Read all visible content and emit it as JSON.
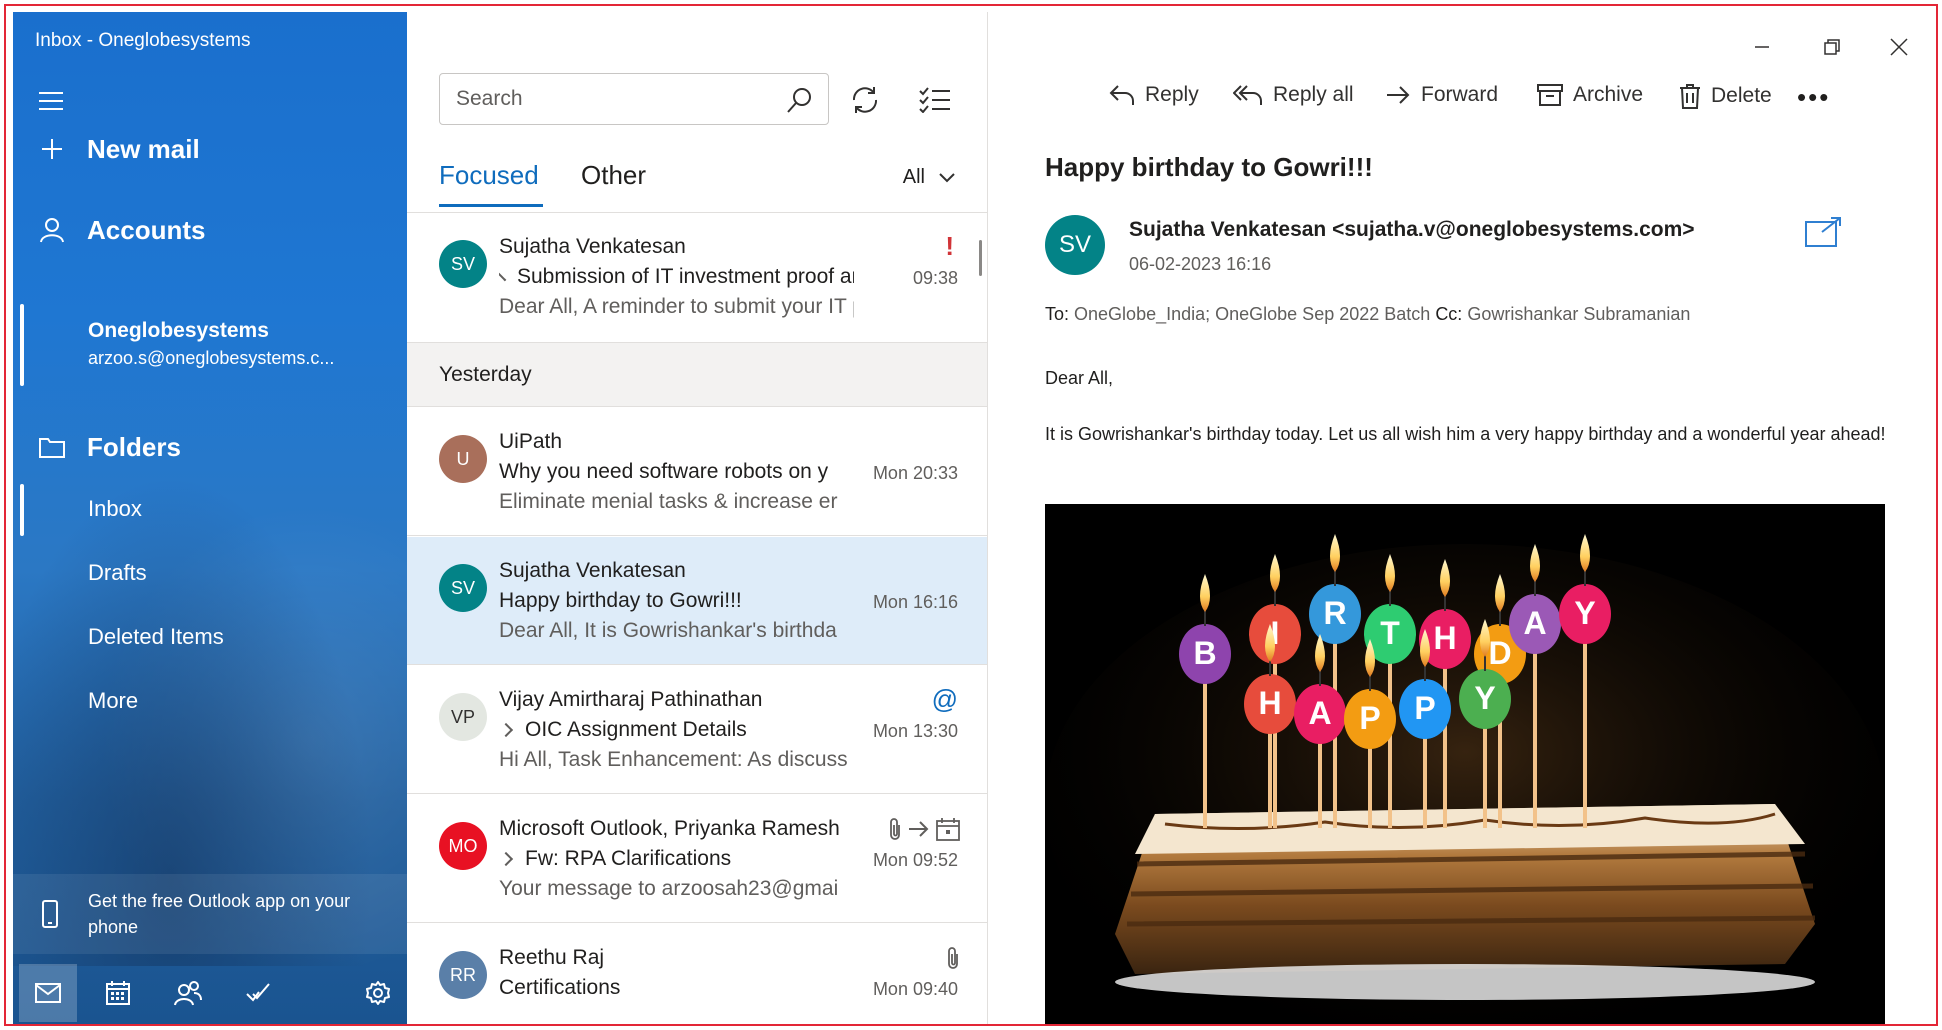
{
  "window": {
    "title": "Inbox - Oneglobesystems"
  },
  "nav": {
    "new_mail": "New mail",
    "accounts": "Accounts",
    "account_name": "Oneglobesystems",
    "account_email": "arzoo.s@oneglobesystems.c...",
    "folders": "Folders",
    "folder_items": [
      "Inbox",
      "Drafts",
      "Deleted Items",
      "More"
    ],
    "promo": "Get the free Outlook app on your phone"
  },
  "list": {
    "search_placeholder": "Search",
    "tabs": [
      "Focused",
      "Other"
    ],
    "filter": "All",
    "section_yesterday": "Yesterday",
    "messages": [
      {
        "initials": "SV",
        "color": "#038387",
        "from": "Sujatha Venkatesan",
        "subject": "Submission of IT investment proof and",
        "preview": "Dear All, A reminder to submit your IT pr",
        "time": "09:38",
        "flag": "!"
      },
      {
        "initials": "U",
        "color": "#a96f5b",
        "from": "UiPath",
        "subject": "Why you need software robots on y",
        "preview": "Eliminate menial tasks & increase er",
        "time": "Mon 20:33"
      },
      {
        "initials": "SV",
        "color": "#038387",
        "from": "Sujatha Venkatesan",
        "subject": "Happy birthday to Gowri!!!",
        "preview": "Dear All, It is Gowrishankar's birthda",
        "time": "Mon 16:16"
      },
      {
        "initials": "VP",
        "color": "#e3e7e1",
        "from": "Vijay Amirtharaj Pathinathan",
        "subject": "OIC Assignment Details",
        "preview": "Hi All, Task Enhancement: As discuss",
        "time": "Mon 13:30",
        "mention": "@"
      },
      {
        "initials": "MO",
        "color": "#e81123",
        "from": "Microsoft Outlook, Priyanka Ramesh",
        "subject": "Fw: RPA Clarifications",
        "preview": "Your message to arzoosah23@gmai",
        "time": "Mon 09:52"
      },
      {
        "initials": "RR",
        "color": "#5a7fa8",
        "from": "Reethu Raj",
        "subject": "Certifications",
        "preview": "",
        "time": "Mon 09:40"
      }
    ]
  },
  "reading": {
    "commands": [
      "Reply",
      "Reply all",
      "Forward",
      "Archive",
      "Delete"
    ],
    "more": "•••",
    "subject": "Happy birthday to Gowri!!!",
    "avatar": "SV",
    "sender": "Sujatha Venkatesan <sujatha.v@oneglobesystems.com>",
    "date": "06-02-2023 16:16",
    "to_label": "To:",
    "to": "OneGlobe_India; OneGlobe Sep 2022 Batch",
    "cc_label": "Cc:",
    "cc": "Gowrishankar Subramanian",
    "greeting": "Dear All,",
    "body": "It is Gowrishankar's birthday today. Let us all wish him a very happy birthday and a wonderful year ahead!",
    "candle_letters": [
      "B",
      "I",
      "R",
      "T",
      "H",
      "D",
      "A",
      "Y",
      "H",
      "A",
      "P",
      "P",
      "Y"
    ]
  },
  "colors": {
    "accent": "#0f6cbd",
    "nav_blue": "#1f77d2",
    "selected_row": "#deecf9",
    "flag_red": "#d13438"
  }
}
